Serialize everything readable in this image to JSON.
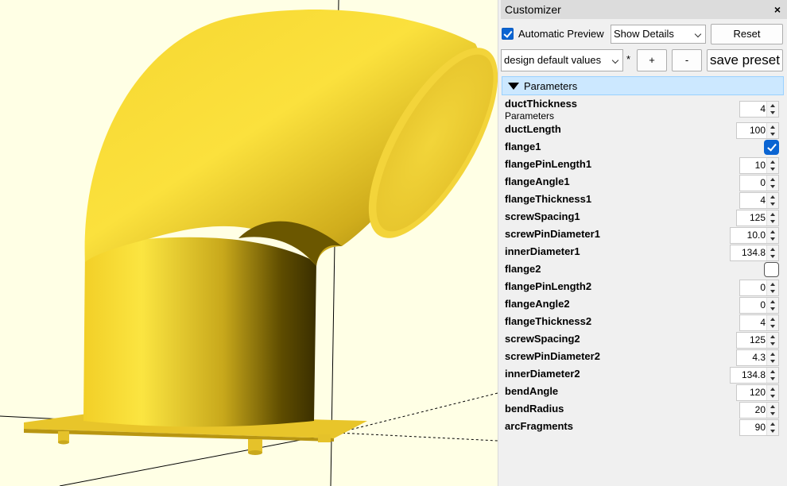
{
  "window": {
    "title": "Customizer",
    "close_glyph": "×"
  },
  "toolbar": {
    "auto_preview_label": "Automatic Preview",
    "auto_preview_checked": true,
    "details_select": "Show Details",
    "reset_label": "Reset",
    "preset_select": "design default values",
    "modified_marker": "*",
    "add_label": "+",
    "remove_label": "-",
    "save_preset_label": "save preset"
  },
  "group": {
    "label": "Parameters"
  },
  "params": [
    {
      "name": "ductThickness",
      "desc": "Parameters",
      "type": "spin",
      "value": "4"
    },
    {
      "name": "ductLength",
      "type": "spin",
      "value": "100"
    },
    {
      "name": "flange1",
      "type": "check",
      "checked": true
    },
    {
      "name": "flangePinLength1",
      "type": "spin",
      "value": "10"
    },
    {
      "name": "flangeAngle1",
      "type": "spin",
      "value": "0"
    },
    {
      "name": "flangeThickness1",
      "type": "spin",
      "value": "4"
    },
    {
      "name": "screwSpacing1",
      "type": "spin",
      "value": "125"
    },
    {
      "name": "screwPinDiameter1",
      "type": "spin",
      "value": "10.0"
    },
    {
      "name": "innerDiameter1",
      "type": "spin",
      "value": "134.8"
    },
    {
      "name": "flange2",
      "type": "check",
      "checked": false
    },
    {
      "name": "flangePinLength2",
      "type": "spin",
      "value": "0"
    },
    {
      "name": "flangeAngle2",
      "type": "spin",
      "value": "0"
    },
    {
      "name": "flangeThickness2",
      "type": "spin",
      "value": "4"
    },
    {
      "name": "screwSpacing2",
      "type": "spin",
      "value": "125"
    },
    {
      "name": "screwPinDiameter2",
      "type": "spin",
      "value": "4.3"
    },
    {
      "name": "innerDiameter2",
      "type": "spin",
      "value": "134.8"
    },
    {
      "name": "bendAngle",
      "type": "spin",
      "value": "120"
    },
    {
      "name": "bendRadius",
      "type": "spin",
      "value": "20"
    },
    {
      "name": "arcFragments",
      "type": "spin",
      "value": "90"
    }
  ],
  "colors": {
    "model": "#f9d83a",
    "viewport_bg": "#ffffe5",
    "accent": "#0a64d2",
    "group_bg": "#cce8ff"
  }
}
